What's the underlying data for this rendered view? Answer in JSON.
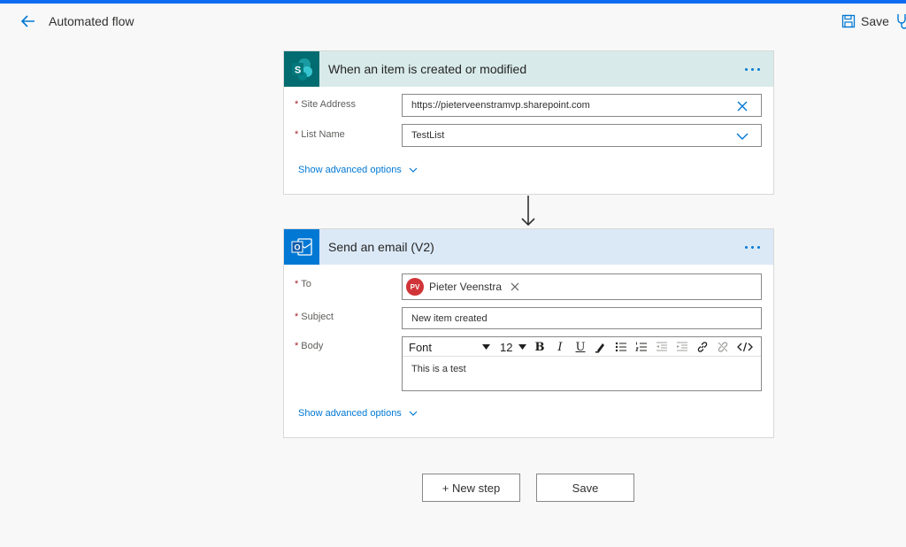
{
  "header": {
    "title": "Automated flow",
    "save_label": "Save",
    "back_icon": "arrow-left-icon",
    "save_icon": "floppy-disk-icon"
  },
  "trigger_card": {
    "title": "When an item is created or modified",
    "icon": "sharepoint-icon",
    "header_color": "#d8ebea",
    "accent_color": "#036c70",
    "fields": {
      "site_address_label": "Site Address",
      "site_address_value": "https://pieterveenstramvp.sharepoint.com",
      "list_name_label": "List Name",
      "list_name_value": "TestList"
    },
    "show_advanced": "Show advanced options"
  },
  "action_card": {
    "title": "Send an email (V2)",
    "icon": "outlook-icon",
    "header_color": "#dbe9f7",
    "accent_color": "#0078d4",
    "fields": {
      "to_label": "To",
      "to_initials": "PV",
      "to_name": "Pieter Veenstra",
      "subject_label": "Subject",
      "subject_value": "New item created",
      "body_label": "Body",
      "body_value": "This is a test"
    },
    "toolbar": {
      "font": "Font",
      "size": "12",
      "bold": "B",
      "italic": "I",
      "underline": "U"
    },
    "show_advanced": "Show advanced options"
  },
  "footer": {
    "new_step_label": "+ New step",
    "save_label": "Save"
  }
}
